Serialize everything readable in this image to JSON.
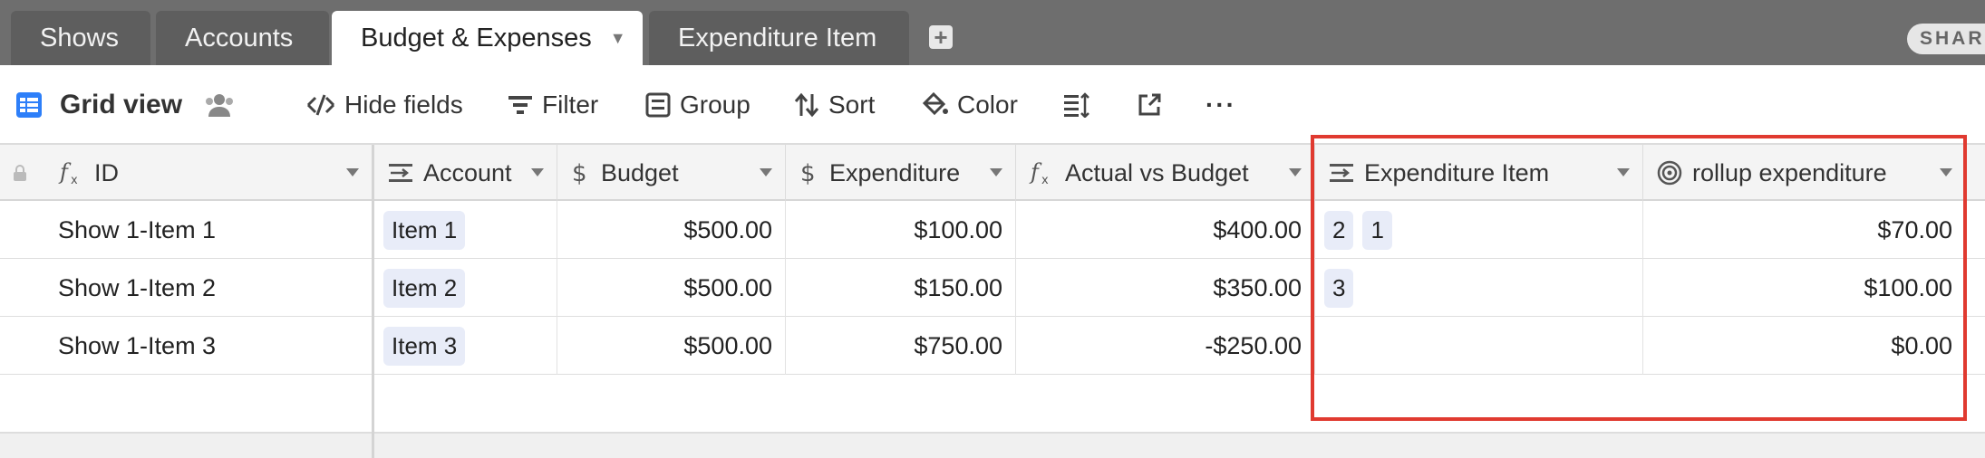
{
  "tabs": [
    {
      "label": "Shows"
    },
    {
      "label": "Accounts"
    },
    {
      "label": "Budget & Expenses",
      "active": true
    },
    {
      "label": "Expenditure Item"
    }
  ],
  "share_label": "SHARE",
  "toolbar": {
    "view_name": "Grid view",
    "hide_fields": "Hide fields",
    "filter": "Filter",
    "group": "Group",
    "sort": "Sort",
    "color": "Color",
    "more": "···"
  },
  "columns": {
    "id": "ID",
    "account": "Account",
    "budget": "Budget",
    "expenditure": "Expenditure",
    "actual_vs_budget": "Actual vs Budget",
    "expenditure_item": "Expenditure Item",
    "rollup": "rollup expenditure"
  },
  "rows": [
    {
      "id": "Show 1-Item 1",
      "account": "Item 1",
      "budget": "$500.00",
      "expenditure": "$100.00",
      "actual_vs_budget": "$400.00",
      "items": [
        "2",
        "1"
      ],
      "rollup": "$70.00"
    },
    {
      "id": "Show 1-Item 2",
      "account": "Item 2",
      "budget": "$500.00",
      "expenditure": "$150.00",
      "actual_vs_budget": "$350.00",
      "items": [
        "3"
      ],
      "rollup": "$100.00"
    },
    {
      "id": "Show 1-Item 3",
      "account": "Item 3",
      "budget": "$500.00",
      "expenditure": "$750.00",
      "actual_vs_budget": "-$250.00",
      "items": [],
      "rollup": "$0.00"
    }
  ],
  "colors": {
    "highlight": "#e03a30",
    "chip": "#e8ecf8",
    "accent": "#2d7ff9"
  }
}
